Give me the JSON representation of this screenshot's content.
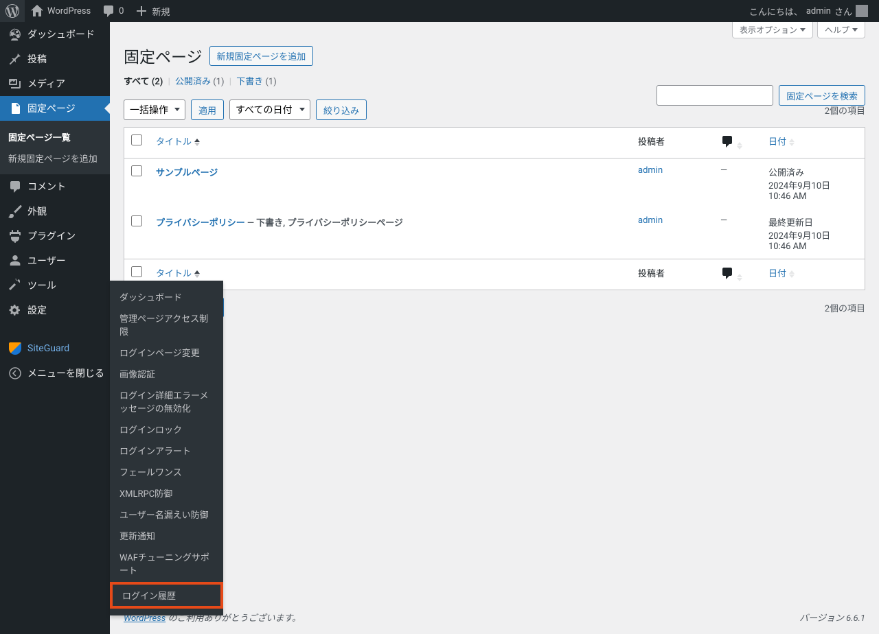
{
  "adminbar": {
    "site_name": "WordPress",
    "comments_count": "0",
    "new_label": "新規",
    "greeting": "こんにちは、",
    "user": "admin",
    "greeting_suffix": " さん"
  },
  "sidebar": {
    "dashboard": "ダッシュボード",
    "posts": "投稿",
    "media": "メディア",
    "pages": "固定ページ",
    "pages_sub_index": "固定ページ一覧",
    "pages_sub_new": "新規固定ページを追加",
    "comments": "コメント",
    "appearance": "外観",
    "plugins": "プラグイン",
    "users": "ユーザー",
    "tools": "ツール",
    "settings": "設定",
    "siteguard": "SiteGuard",
    "collapse": "メニューを閉じる"
  },
  "siteguard_flyout": {
    "dashboard": "ダッシュボード",
    "admin_restrict": "管理ページアクセス制限",
    "login_page": "ログインページ変更",
    "captcha": "画像認証",
    "error_msg": "ログイン詳細エラーメッセージの無効化",
    "lock": "ログインロック",
    "alert": "ログインアラート",
    "failonce": "フェールワンス",
    "xmlrpc": "XMLRPC防御",
    "username": "ユーザー名漏えい防御",
    "update_notify": "更新通知",
    "waf": "WAFチューニングサポート",
    "history": "ログイン履歴"
  },
  "screen_meta": {
    "options": "表示オプション",
    "help": "ヘルプ"
  },
  "page": {
    "title": "固定ページ",
    "add_new": "新規固定ページを追加",
    "search_btn": "固定ページを検索"
  },
  "subsubsub": {
    "all": "すべて",
    "all_count": "(2)",
    "published": "公開済み",
    "published_count": "(1)",
    "draft": "下書き",
    "draft_count": "(1)"
  },
  "tablenav": {
    "bulk_action": "一括操作",
    "apply": "適用",
    "all_dates": "すべての日付",
    "filter": "絞り込み",
    "items_count": "2個の項目"
  },
  "table": {
    "col_title": "タイトル",
    "col_author": "投稿者",
    "col_date": "日付"
  },
  "rows": [
    {
      "title": "サンプルページ",
      "state": "",
      "author": "admin",
      "comments": "—",
      "date_status": "公開済み",
      "date_line1": "2024年9月10日",
      "date_line2": "10:46 AM"
    },
    {
      "title": "プライバシーポリシー",
      "state": " — 下書き, プライバシーポリシーページ",
      "author": "admin",
      "comments": "—",
      "date_status": "最終更新日",
      "date_line1": "2024年9月10日",
      "date_line2": "10:46 AM"
    }
  ],
  "footer": {
    "wp_link": "WordPress",
    "thanks": " のご利用ありがとうございます。",
    "version": "バージョン 6.6.1"
  }
}
